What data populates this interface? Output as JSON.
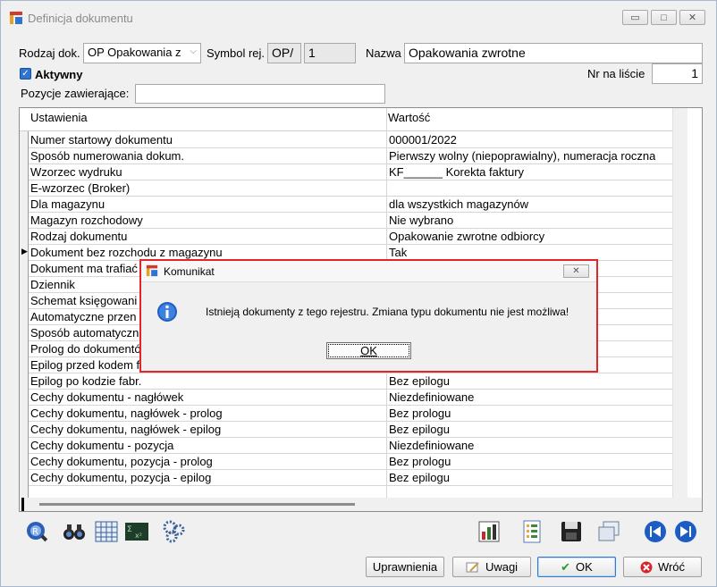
{
  "window": {
    "title": "Definicja dokumentu",
    "controls": {
      "minimize": "▭",
      "maximize": "□",
      "close": "✕"
    }
  },
  "form": {
    "rodzaj_label": "Rodzaj dok.",
    "rodzaj_value": "OP Opakowania z",
    "symbol_label": "Symbol rej.",
    "symbol_prefix": "OP/",
    "symbol_number": "1",
    "nazwa_label": "Nazwa",
    "nazwa_value": "Opakowania zwrotne",
    "aktywny_label": "Aktywny",
    "nr_label": "Nr na liście",
    "nr_value": "1",
    "pozycje_label": "Pozycje zawierające:",
    "pozycje_value": ""
  },
  "grid": {
    "headers": {
      "col1": "Ustawienia",
      "col2": "Wartość"
    },
    "rows": [
      {
        "setting": "Numer startowy dokumentu",
        "value": "000001/2022"
      },
      {
        "setting": "Sposób numerowania dokum.",
        "value": "Pierwszy wolny  (niepoprawialny), numeracja roczna"
      },
      {
        "setting": "Wzorzec wydruku",
        "value": "KF______ Korekta faktury"
      },
      {
        "setting": "E-wzorzec (Broker)",
        "value": ""
      },
      {
        "setting": "Dla magazynu",
        "value": "dla wszystkich magazynów"
      },
      {
        "setting": "Magazyn rozchodowy",
        "value": "Nie wybrano"
      },
      {
        "setting": "Rodzaj dokumentu",
        "value": "Opakowanie zwrotne odbiorcy"
      },
      {
        "setting": "Dokument bez rozchodu z magazynu",
        "value": "Tak"
      },
      {
        "setting": "Dokument ma trafiać",
        "value": ""
      },
      {
        "setting": "Dziennik",
        "value": ""
      },
      {
        "setting": "Schemat księgowani",
        "value": ""
      },
      {
        "setting": "Automatyczne przen",
        "value": ""
      },
      {
        "setting": "Sposób automatyczn",
        "value": ""
      },
      {
        "setting": "Prolog do dokumentó",
        "value": ""
      },
      {
        "setting": "Epilog przed kodem f",
        "value": ""
      },
      {
        "setting": "Epilog po kodzie fabr.",
        "value": "Bez epilogu"
      },
      {
        "setting": "Cechy dokumentu - nagłówek",
        "value": "Niezdefiniowane"
      },
      {
        "setting": "Cechy dokumentu, nagłówek - prolog",
        "value": "Bez prologu"
      },
      {
        "setting": "Cechy dokumentu, nagłówek - epilog",
        "value": "Bez epilogu"
      },
      {
        "setting": "Cechy dokumentu - pozycja",
        "value": "Niezdefiniowane"
      },
      {
        "setting": "Cechy dokumentu, pozycja - prolog",
        "value": "Bez prologu"
      },
      {
        "setting": "Cechy dokumentu, pozycja - epilog",
        "value": "Bez epilogu"
      }
    ],
    "current_row_marker": "▶"
  },
  "toolbar_icons": [
    "search-zoom-icon",
    "binoculars-icon",
    "calculator-grid-icon",
    "formula-icon",
    "gears-icon",
    "bar-chart-icon",
    "document-list-icon",
    "save-icon",
    "copy-windows-icon",
    "previous-icon",
    "next-icon"
  ],
  "buttons": {
    "uprawnienia": "Uprawnienia",
    "uwagi": "Uwagi",
    "ok": "OK",
    "wroc": "Wróć"
  },
  "dialog": {
    "title": "Komunikat",
    "message": "Istnieją dokumenty z tego rejestru. Zmiana typu dokumentu nie jest możliwa!",
    "ok": "OK",
    "close": "✕"
  },
  "colors": {
    "accent": "#2b7bd6",
    "dialog_border": "#e0262b",
    "info_icon": "#1f5fbf"
  }
}
